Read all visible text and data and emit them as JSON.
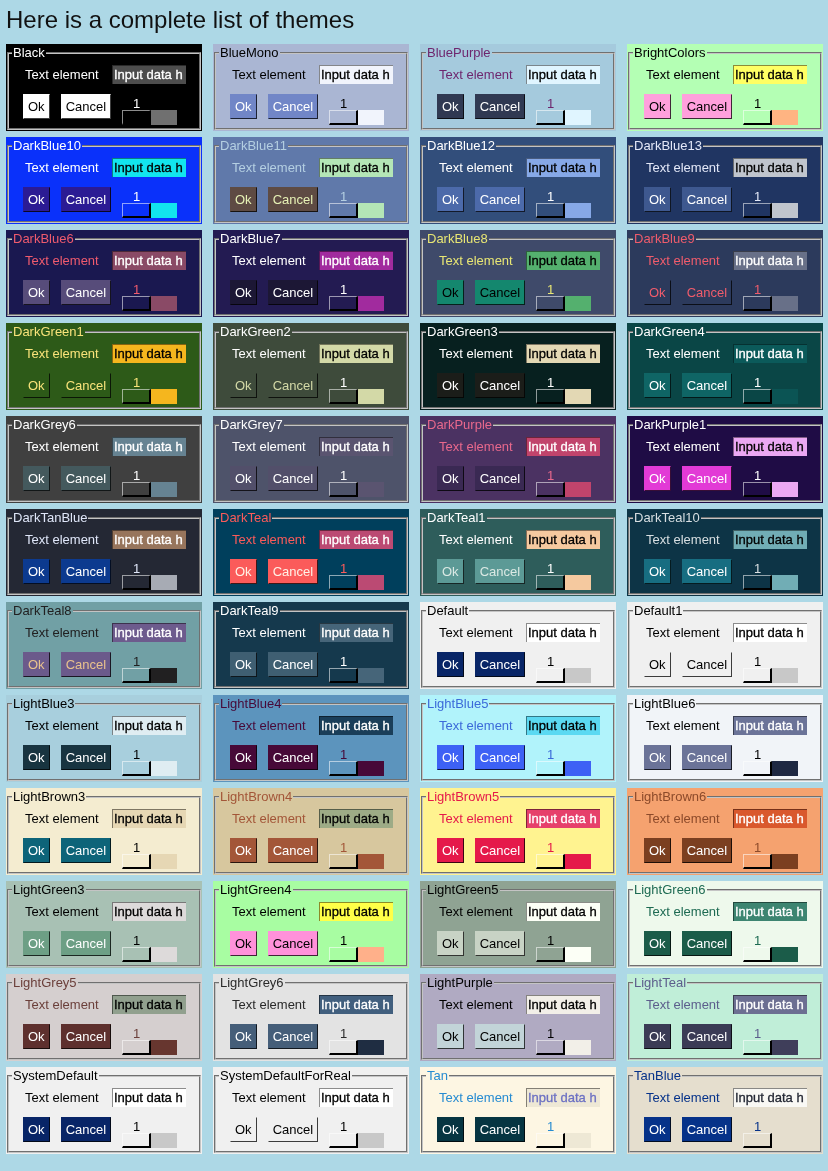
{
  "title": "Here is a complete list of themes",
  "themes": [
    {
      "name": "Black",
      "color": "#000000",
      "foreground": {
        "color": "#ffffff"
      },
      "label": "Text element",
      "input": {
        "value": "Input data h",
        "color": "#4d4d4d",
        "foreground": {
          "color": "#ffffff"
        }
      },
      "button": {
        "color": "#ffffff",
        "foreground": {
          "color": "#000000"
        }
      },
      "buttons": [
        "Ok",
        "Cancel"
      ],
      "slider": {
        "value": "1",
        "level": 0,
        "color": "#707070"
      }
    },
    {
      "name": "BlueMono",
      "color": "#aab6d3",
      "foreground": {
        "color": "#000000"
      },
      "label": "Text element",
      "input": {
        "value": "Input data h",
        "color": "#f1f4fc",
        "foreground": {
          "color": "#000000"
        }
      },
      "button": {
        "color": "#7186c7",
        "foreground": {
          "color": "#ffffff"
        }
      },
      "buttons": [
        "Ok",
        "Cancel"
      ],
      "slider": {
        "value": "1",
        "level": 0,
        "color": "#f1f4fc"
      }
    },
    {
      "name": "BluePurple",
      "color": "#a5cadd",
      "foreground": {
        "color": "#6e266e"
      },
      "label": "Text element",
      "input": {
        "value": "Input data h",
        "color": "#e0f5ff",
        "foreground": {
          "color": "#000000"
        }
      },
      "button": {
        "color": "#303952",
        "foreground": {
          "color": "#ffffff"
        }
      },
      "buttons": [
        "Ok",
        "Cancel"
      ],
      "slider": {
        "value": "1",
        "level": 0,
        "color": "#e0f5ff"
      }
    },
    {
      "name": "BrightColors",
      "color": "#b4ffb4",
      "foreground": {
        "color": "#000000"
      },
      "label": "Text element",
      "input": {
        "value": "Input data h",
        "color": "#ffff64",
        "foreground": {
          "color": "#000000"
        }
      },
      "button": {
        "color": "#ffa0dc",
        "foreground": {
          "color": "#000000"
        }
      },
      "buttons": [
        "Ok",
        "Cancel"
      ],
      "slider": {
        "value": "1",
        "level": 0,
        "color": "#ffb482"
      }
    },
    {
      "name": "DarkBlue10",
      "color": "#0a31fa",
      "foreground": {
        "color": "#ffffff"
      },
      "label": "Text element",
      "input": {
        "value": "Input data h",
        "color": "#12e5ee",
        "foreground": {
          "color": "#000000"
        }
      },
      "button": {
        "color": "#2b1b94",
        "foreground": {
          "color": "#ffffff"
        }
      },
      "buttons": [
        "Ok",
        "Cancel"
      ],
      "slider": {
        "value": "1",
        "level": 0,
        "color": "#12e5ee"
      }
    },
    {
      "name": "DarkBlue11",
      "color": "#6079aa",
      "foreground": {
        "color": "#b4cfe2"
      },
      "label": "Text element",
      "input": {
        "value": "Input data h",
        "color": "#b4e6b6",
        "foreground": {
          "color": "#000000"
        }
      },
      "button": {
        "color": "#5e4b43",
        "foreground": {
          "color": "#e6f1b5"
        }
      },
      "buttons": [
        "Ok",
        "Cancel"
      ],
      "slider": {
        "value": "1",
        "level": 0,
        "color": "#b4e6b6"
      }
    },
    {
      "name": "DarkBlue12",
      "color": "#324e7b",
      "foreground": {
        "color": "#ffffff"
      },
      "label": "Text element",
      "input": {
        "value": "Input data h",
        "color": "#86a8e7",
        "foreground": {
          "color": "#000000"
        }
      },
      "button": {
        "color": "#4c6aaa",
        "foreground": {
          "color": "#ffffff"
        }
      },
      "buttons": [
        "Ok",
        "Cancel"
      ],
      "slider": {
        "value": "1",
        "level": 0,
        "color": "#86a8e7"
      }
    },
    {
      "name": "DarkBlue13",
      "color": "#203562",
      "foreground": {
        "color": "#e3e8f8"
      },
      "label": "Text element",
      "input": {
        "value": "Input data h",
        "color": "#c0c5cd",
        "foreground": {
          "color": "#000000"
        }
      },
      "button": {
        "color": "#3e588f",
        "foreground": {
          "color": "#ffffff"
        }
      },
      "buttons": [
        "Ok",
        "Cancel"
      ],
      "slider": {
        "value": "1",
        "level": 0,
        "color": "#c0c5cd"
      }
    },
    {
      "name": "DarkBlue6",
      "color": "#1a1850",
      "foreground": {
        "color": "#f05b6e"
      },
      "label": "Text element",
      "input": {
        "value": "Input data h",
        "color": "#8a4a66",
        "foreground": {
          "color": "#ffffff"
        }
      },
      "button": {
        "color": "#574c7a",
        "foreground": {
          "color": "#ffffff"
        }
      },
      "buttons": [
        "Ok",
        "Cancel"
      ],
      "slider": {
        "value": "1",
        "level": 0,
        "color": "#8a4a66"
      }
    },
    {
      "name": "DarkBlue7",
      "color": "#231b52",
      "foreground": {
        "color": "#ffffff"
      },
      "label": "Text element",
      "input": {
        "value": "Input data h",
        "color": "#a12b9e",
        "foreground": {
          "color": "#ffffff"
        }
      },
      "button": {
        "color": "#1c1735",
        "foreground": {
          "color": "#ffffff"
        }
      },
      "buttons": [
        "Ok",
        "Cancel"
      ],
      "slider": {
        "value": "1",
        "level": 0,
        "color": "#a12b9e"
      }
    },
    {
      "name": "DarkBlue8",
      "color": "#3f4a6a",
      "foreground": {
        "color": "#e8e674"
      },
      "label": "Text element",
      "input": {
        "value": "Input data h",
        "color": "#54b06e",
        "foreground": {
          "color": "#000000"
        }
      },
      "button": {
        "color": "#14876e",
        "foreground": {
          "color": "#000000"
        }
      },
      "buttons": [
        "Ok",
        "Cancel"
      ],
      "slider": {
        "value": "1",
        "level": 0,
        "color": "#54b06e"
      }
    },
    {
      "name": "DarkBlue9",
      "color": "#2c3a5c",
      "foreground": {
        "color": "#f05c6c"
      },
      "label": "Text element",
      "input": {
        "value": "Input data h",
        "color": "#687088",
        "foreground": {
          "color": "#ffffff"
        }
      },
      "button": {
        "color": "#2c3a5c",
        "foreground": {
          "color": "#f05c6c"
        }
      },
      "buttons": [
        "Ok",
        "Cancel"
      ],
      "slider": {
        "value": "1",
        "level": 0,
        "color": "#687088"
      }
    },
    {
      "name": "DarkGreen1",
      "color": "#2d5a18",
      "foreground": {
        "color": "#f9e37a"
      },
      "label": "Text element",
      "input": {
        "value": "Input data h",
        "color": "#f5b61e",
        "foreground": {
          "color": "#000000"
        }
      },
      "button": {
        "color": "#2d5a18",
        "foreground": {
          "color": "#f9e37a"
        }
      },
      "buttons": [
        "Ok",
        "Cancel"
      ],
      "slider": {
        "value": "1",
        "level": 0,
        "color": "#f5b61e"
      }
    },
    {
      "name": "DarkGreen2",
      "color": "#3e4b3b",
      "foreground": {
        "color": "#ffffff"
      },
      "label": "Text element",
      "input": {
        "value": "Input data h",
        "color": "#d3d9a7",
        "foreground": {
          "color": "#000000"
        }
      },
      "button": {
        "color": "#3e4b3b",
        "foreground": {
          "color": "#d3d9a7"
        }
      },
      "buttons": [
        "Ok",
        "Cancel"
      ],
      "slider": {
        "value": "1",
        "level": 0,
        "color": "#d3d9a7"
      }
    },
    {
      "name": "DarkGreen3",
      "color": "#07201f",
      "foreground": {
        "color": "#ffffff"
      },
      "label": "Text element",
      "input": {
        "value": "Input data h",
        "color": "#e3d8b4",
        "foreground": {
          "color": "#000000"
        }
      },
      "button": {
        "color": "#1b1d19",
        "foreground": {
          "color": "#ffffff"
        }
      },
      "buttons": [
        "Ok",
        "Cancel"
      ],
      "slider": {
        "value": "1",
        "level": 0,
        "color": "#e3d8b4"
      }
    },
    {
      "name": "DarkGreen4",
      "color": "#0a4646",
      "foreground": {
        "color": "#ffffff"
      },
      "label": "Text element",
      "input": {
        "value": "Input data h",
        "color": "#0b5a5a",
        "foreground": {
          "color": "#ffffff"
        }
      },
      "button": {
        "color": "#0f6565",
        "foreground": {
          "color": "#ffffff"
        }
      },
      "buttons": [
        "Ok",
        "Cancel"
      ],
      "slider": {
        "value": "1",
        "level": 0,
        "color": "#0b5454"
      }
    },
    {
      "name": "DarkGrey6",
      "color": "#404040",
      "foreground": {
        "color": "#ffffff"
      },
      "label": "Text element",
      "input": {
        "value": "Input data h",
        "color": "#668392",
        "foreground": {
          "color": "#ffffff"
        }
      },
      "button": {
        "color": "#44595d",
        "foreground": {
          "color": "#ffffff"
        }
      },
      "buttons": [
        "Ok",
        "Cancel"
      ],
      "slider": {
        "value": "1",
        "level": 0,
        "color": "#668392"
      }
    },
    {
      "name": "DarkGrey7",
      "color": "#4e536a",
      "foreground": {
        "color": "#ffffff"
      },
      "label": "Text element",
      "input": {
        "value": "Input data h",
        "color": "#5a5470",
        "foreground": {
          "color": "#ffffff"
        }
      },
      "button": {
        "color": "#524f6a",
        "foreground": {
          "color": "#ffffff"
        }
      },
      "buttons": [
        "Ok",
        "Cancel"
      ],
      "slider": {
        "value": "1",
        "level": 0,
        "color": "#5a5470"
      }
    },
    {
      "name": "DarkPurple",
      "color": "#4b3262",
      "foreground": {
        "color": "#e8688c"
      },
      "label": "Text element",
      "input": {
        "value": "Input data h",
        "color": "#c1446c",
        "foreground": {
          "color": "#ffffff"
        }
      },
      "button": {
        "color": "#3a2953",
        "foreground": {
          "color": "#ffffff"
        }
      },
      "buttons": [
        "Ok",
        "Cancel"
      ],
      "slider": {
        "value": "1",
        "level": 0,
        "color": "#c1446c"
      }
    },
    {
      "name": "DarkPurple1",
      "color": "#1f0c45",
      "foreground": {
        "color": "#ffffff"
      },
      "label": "Text element",
      "input": {
        "value": "Input data h",
        "color": "#eba8f3",
        "foreground": {
          "color": "#000000"
        }
      },
      "button": {
        "color": "#e23ad6",
        "foreground": {
          "color": "#ffffff"
        }
      },
      "buttons": [
        "Ok",
        "Cancel"
      ],
      "slider": {
        "value": "1",
        "level": 0,
        "color": "#eba8f3"
      }
    },
    {
      "name": "DarkTanBlue",
      "color": "#242834",
      "foreground": {
        "color": "#dfe6f8"
      },
      "label": "Text element",
      "input": {
        "value": "Input data h",
        "color": "#97755c",
        "foreground": {
          "color": "#ffffff"
        }
      },
      "button": {
        "color": "#0c3a8f",
        "foreground": {
          "color": "#ffffff"
        }
      },
      "buttons": [
        "Ok",
        "Cancel"
      ],
      "slider": {
        "value": "1",
        "level": 0,
        "color": "#a7abb4"
      }
    },
    {
      "name": "DarkTeal",
      "color": "#003f5c",
      "foreground": {
        "color": "#fb5b5a"
      },
      "label": "Text element",
      "input": {
        "value": "Input data h",
        "color": "#bb4a73",
        "foreground": {
          "color": "#ffffff"
        }
      },
      "button": {
        "color": "#fb5b5a",
        "foreground": {
          "color": "#fff1e6"
        }
      },
      "buttons": [
        "Ok",
        "Cancel"
      ],
      "slider": {
        "value": "1",
        "level": 0,
        "color": "#bb4a73"
      }
    },
    {
      "name": "DarkTeal1",
      "color": "#2e5d5b",
      "foreground": {
        "color": "#ffffff"
      },
      "label": "Text element",
      "input": {
        "value": "Input data h",
        "color": "#f5c99f",
        "foreground": {
          "color": "#000000"
        }
      },
      "button": {
        "color": "#5c9a96",
        "foreground": {
          "color": "#dbe9e4"
        }
      },
      "buttons": [
        "Ok",
        "Cancel"
      ],
      "slider": {
        "value": "1",
        "level": 0,
        "color": "#f5c99f"
      }
    },
    {
      "name": "DarkTeal10",
      "color": "#0d3446",
      "foreground": {
        "color": "#d8dfe2"
      },
      "label": "Text element",
      "input": {
        "value": "Input data h",
        "color": "#71adb5",
        "foreground": {
          "color": "#000000"
        }
      },
      "button": {
        "color": "#176d81",
        "foreground": {
          "color": "#ffffff"
        }
      },
      "buttons": [
        "Ok",
        "Cancel"
      ],
      "slider": {
        "value": "1",
        "level": 0,
        "color": "#71adb5"
      }
    },
    {
      "name": "DarkTeal8",
      "color": "#71a0a5",
      "foreground": {
        "color": "#212021"
      },
      "label": "Text element",
      "input": {
        "value": "Input data h",
        "color": "#6d5b8d",
        "foreground": {
          "color": "#ffffff"
        }
      },
      "button": {
        "color": "#6b5a8b",
        "foreground": {
          "color": "#e9c28d"
        }
      },
      "buttons": [
        "Ok",
        "Cancel"
      ],
      "slider": {
        "value": "1",
        "level": 0,
        "color": "#212021"
      }
    },
    {
      "name": "DarkTeal9",
      "color": "#15394d",
      "foreground": {
        "color": "#ffffff"
      },
      "label": "Text element",
      "input": {
        "value": "Input data h",
        "color": "#466579",
        "foreground": {
          "color": "#ffffff"
        }
      },
      "button": {
        "color": "#3f5f72",
        "foreground": {
          "color": "#ffffff"
        }
      },
      "buttons": [
        "Ok",
        "Cancel"
      ],
      "slider": {
        "value": "1",
        "level": 0,
        "color": "#466579"
      }
    },
    {
      "name": "Default",
      "color": "#f0f0f0",
      "foreground": {
        "color": "#000000"
      },
      "label": "Text element",
      "input": {
        "value": "Input data h",
        "color": "#ffffff",
        "foreground": {
          "color": "#000000"
        }
      },
      "button": {
        "color": "#082567",
        "foreground": {
          "color": "#ffffff"
        }
      },
      "buttons": [
        "Ok",
        "Cancel"
      ],
      "slider": {
        "value": "1",
        "level": 0,
        "color": "#c8c8c8"
      }
    },
    {
      "name": "Default1",
      "color": "#f0f0f0",
      "foreground": {
        "color": "#000000"
      },
      "label": "Text element",
      "input": {
        "value": "Input data h",
        "color": "#ffffff",
        "foreground": {
          "color": "#000000"
        }
      },
      "button": {
        "color": "#f0f0f0",
        "foreground": {
          "color": "#000000"
        }
      },
      "buttons": [
        "Ok",
        "Cancel"
      ],
      "slider": {
        "value": "1",
        "level": 0,
        "color": "#c8c8c8"
      }
    },
    {
      "name": "LightBlue3",
      "color": "#a8cfdd",
      "foreground": {
        "color": "#000000"
      },
      "label": "Text element",
      "input": {
        "value": "Input data h",
        "color": "#dfedf2",
        "foreground": {
          "color": "#000000"
        }
      },
      "button": {
        "color": "#183440",
        "foreground": {
          "color": "#ffffff"
        }
      },
      "buttons": [
        "Ok",
        "Cancel"
      ],
      "slider": {
        "value": "1",
        "level": 0,
        "color": "#dfedf2"
      }
    },
    {
      "name": "LightBlue4",
      "color": "#5c94bd",
      "foreground": {
        "color": "#470938"
      },
      "label": "Text element",
      "input": {
        "value": "Input data h",
        "color": "#1a3e59",
        "foreground": {
          "color": "#ffffff"
        }
      },
      "button": {
        "color": "#470938",
        "foreground": {
          "color": "#ffffff"
        }
      },
      "buttons": [
        "Ok",
        "Cancel"
      ],
      "slider": {
        "value": "1",
        "level": 0,
        "color": "#470938"
      }
    },
    {
      "name": "LightBlue5",
      "color": "#b1f3fb",
      "foreground": {
        "color": "#3b6ad9"
      },
      "label": "Text element",
      "input": {
        "value": "Input data h",
        "color": "#5bd9f2",
        "foreground": {
          "color": "#000000"
        }
      },
      "button": {
        "color": "#3d61f5",
        "foreground": {
          "color": "#ffffff"
        }
      },
      "buttons": [
        "Ok",
        "Cancel"
      ],
      "slider": {
        "value": "1",
        "level": 0,
        "color": "#3d61f5"
      }
    },
    {
      "name": "LightBlue6",
      "color": "#f1f4f8",
      "foreground": {
        "color": "#000000"
      },
      "label": "Text element",
      "input": {
        "value": "Input data h",
        "color": "#6b7398",
        "foreground": {
          "color": "#ffffff"
        }
      },
      "button": {
        "color": "#6b7398",
        "foreground": {
          "color": "#ffffff"
        }
      },
      "buttons": [
        "Ok",
        "Cancel"
      ],
      "slider": {
        "value": "1",
        "level": 0,
        "color": "#1e2842"
      }
    },
    {
      "name": "LightBrown3",
      "color": "#f4ecd0",
      "foreground": {
        "color": "#000000"
      },
      "label": "Text element",
      "input": {
        "value": "Input data h",
        "color": "#e6d7b4",
        "foreground": {
          "color": "#000000"
        }
      },
      "button": {
        "color": "#0d6479",
        "foreground": {
          "color": "#ffffff"
        }
      },
      "buttons": [
        "Ok",
        "Cancel"
      ],
      "slider": {
        "value": "1",
        "level": 0,
        "color": "#e6d7b4"
      }
    },
    {
      "name": "LightBrown4",
      "color": "#d7c79e",
      "foreground": {
        "color": "#a35638"
      },
      "label": "Text element",
      "input": {
        "value": "Input data h",
        "color": "#9dab86",
        "foreground": {
          "color": "#000000"
        }
      },
      "button": {
        "color": "#a35638",
        "foreground": {
          "color": "#ffffff"
        }
      },
      "buttons": [
        "Ok",
        "Cancel"
      ],
      "slider": {
        "value": "1",
        "level": 0,
        "color": "#a35638"
      }
    },
    {
      "name": "LightBrown5",
      "color": "#fff390",
      "foreground": {
        "color": "#e5194a"
      },
      "label": "Text element",
      "input": {
        "value": "Input data h",
        "color": "#e6406b",
        "foreground": {
          "color": "#ffffff"
        }
      },
      "button": {
        "color": "#e5194a",
        "foreground": {
          "color": "#ffffff"
        }
      },
      "buttons": [
        "Ok",
        "Cancel"
      ],
      "slider": {
        "value": "1",
        "level": 0,
        "color": "#e5194a"
      }
    },
    {
      "name": "LightBrown6",
      "color": "#f5a26f",
      "foreground": {
        "color": "#8c4a2a"
      },
      "label": "Text element",
      "input": {
        "value": "Input data h",
        "color": "#d9582d",
        "foreground": {
          "color": "#ffffff"
        }
      },
      "button": {
        "color": "#7b3f20",
        "foreground": {
          "color": "#ffffff"
        }
      },
      "buttons": [
        "Ok",
        "Cancel"
      ],
      "slider": {
        "value": "1",
        "level": 0,
        "color": "#7b3f20"
      }
    },
    {
      "name": "LightGreen3",
      "color": "#a8c1b4",
      "foreground": {
        "color": "#000000"
      },
      "label": "Text element",
      "input": {
        "value": "Input data h",
        "color": "#dddada",
        "foreground": {
          "color": "#000000"
        }
      },
      "button": {
        "color": "#6d9f85",
        "foreground": {
          "color": "#ffffff"
        }
      },
      "buttons": [
        "Ok",
        "Cancel"
      ],
      "slider": {
        "value": "1",
        "level": 0,
        "color": "#dddada"
      }
    },
    {
      "name": "LightGreen4",
      "color": "#a8fda2",
      "foreground": {
        "color": "#000000"
      },
      "label": "Text element",
      "input": {
        "value": "Input data h",
        "color": "#ffff48",
        "foreground": {
          "color": "#000000"
        }
      },
      "button": {
        "color": "#ff91da",
        "foreground": {
          "color": "#000000"
        }
      },
      "buttons": [
        "Ok",
        "Cancel"
      ],
      "slider": {
        "value": "1",
        "level": 0,
        "color": "#ffb08a"
      }
    },
    {
      "name": "LightGreen5",
      "color": "#8fa393",
      "foreground": {
        "color": "#000000"
      },
      "label": "Text element",
      "input": {
        "value": "Input data h",
        "color": "#fcfff6",
        "foreground": {
          "color": "#000000"
        }
      },
      "button": {
        "color": "#c8d3c5",
        "foreground": {
          "color": "#000000"
        }
      },
      "buttons": [
        "Ok",
        "Cancel"
      ],
      "slider": {
        "value": "1",
        "level": 0,
        "color": "#fcfff6"
      }
    },
    {
      "name": "LightGreen6",
      "color": "#eef9ec",
      "foreground": {
        "color": "#1d6a52"
      },
      "label": "Text element",
      "input": {
        "value": "Input data h",
        "color": "#3d8571",
        "foreground": {
          "color": "#ffffff"
        }
      },
      "button": {
        "color": "#1b5c49",
        "foreground": {
          "color": "#ffffff"
        }
      },
      "buttons": [
        "Ok",
        "Cancel"
      ],
      "slider": {
        "value": "1",
        "level": 0,
        "color": "#1b5c49"
      }
    },
    {
      "name": "LightGrey5",
      "color": "#d5cfcf",
      "foreground": {
        "color": "#6b3f3a"
      },
      "label": "Text element",
      "input": {
        "value": "Input data h",
        "color": "#91a08e",
        "foreground": {
          "color": "#000000"
        }
      },
      "button": {
        "color": "#5e302e",
        "foreground": {
          "color": "#ffffff"
        }
      },
      "buttons": [
        "Ok",
        "Cancel"
      ],
      "slider": {
        "value": "1",
        "level": 0,
        "color": "#67362f"
      }
    },
    {
      "name": "LightGrey6",
      "color": "#e3e3e3",
      "foreground": {
        "color": "#2a2a2a"
      },
      "label": "Text element",
      "input": {
        "value": "Input data h",
        "color": "#415f7e",
        "foreground": {
          "color": "#ffffff"
        }
      },
      "button": {
        "color": "#455e79",
        "foreground": {
          "color": "#ffffff"
        }
      },
      "buttons": [
        "Ok",
        "Cancel"
      ],
      "slider": {
        "value": "1",
        "level": 0,
        "color": "#1f2d42"
      }
    },
    {
      "name": "LightPurple",
      "color": "#b0aac2",
      "foreground": {
        "color": "#000000"
      },
      "label": "Text element",
      "input": {
        "value": "Input data h",
        "color": "#f2efe8",
        "foreground": {
          "color": "#000000"
        }
      },
      "button": {
        "color": "#c2d4d8",
        "foreground": {
          "color": "#000000"
        }
      },
      "buttons": [
        "Ok",
        "Cancel"
      ],
      "slider": {
        "value": "1",
        "level": 0,
        "color": "#f2efe8"
      }
    },
    {
      "name": "LightTeal",
      "color": "#c0eed8",
      "foreground": {
        "color": "#5c5e8c"
      },
      "label": "Text element",
      "input": {
        "value": "Input data h",
        "color": "#6c6f92",
        "foreground": {
          "color": "#ffffff"
        }
      },
      "button": {
        "color": "#3b3b55",
        "foreground": {
          "color": "#ffffff"
        }
      },
      "buttons": [
        "Ok",
        "Cancel"
      ],
      "slider": {
        "value": "1",
        "level": 0,
        "color": "#3f3e5a"
      }
    },
    {
      "name": "SystemDefault",
      "color": "#f0f0f0",
      "foreground": {
        "color": "#000000"
      },
      "label": "Text element",
      "input": {
        "value": "Input data h",
        "color": "#ffffff",
        "foreground": {
          "color": "#000000"
        }
      },
      "button": {
        "color": "#082567",
        "foreground": {
          "color": "#ffffff"
        }
      },
      "buttons": [
        "Ok",
        "Cancel"
      ],
      "slider": {
        "value": "1",
        "level": 0,
        "color": "#c8c8c8"
      }
    },
    {
      "name": "SystemDefaultForReal",
      "color": "#f0f0f0",
      "foreground": {
        "color": "#000000"
      },
      "label": "Text element",
      "input": {
        "value": "Input data h",
        "color": "#ffffff",
        "foreground": {
          "color": "#000000"
        }
      },
      "button": {
        "color": "#f0f0f0",
        "foreground": {
          "color": "#000000"
        }
      },
      "buttons": [
        "Ok",
        "Cancel"
      ],
      "slider": {
        "value": "1",
        "level": 0,
        "color": "#c8c8c8"
      }
    },
    {
      "name": "Tan",
      "color": "#fdf6e3",
      "foreground": {
        "color": "#268bd1"
      },
      "label": "Text element",
      "input": {
        "value": "Input data h",
        "color": "#eee8d5",
        "foreground": {
          "color": "#6c71c3"
        }
      },
      "button": {
        "color": "#063542",
        "foreground": {
          "color": "#ffffff"
        }
      },
      "buttons": [
        "Ok",
        "Cancel"
      ],
      "slider": {
        "value": "1",
        "level": 0,
        "color": "#eee8d5"
      }
    },
    {
      "name": "TanBlue",
      "color": "#e5dece",
      "foreground": {
        "color": "#063289"
      },
      "label": "Text element",
      "input": {
        "value": "Input data h",
        "color": "#f9f8f4",
        "foreground": {
          "color": "#242834"
        }
      },
      "button": {
        "color": "#063289",
        "foreground": {
          "color": "#ffffff"
        }
      },
      "buttons": [
        "Ok",
        "Cancel"
      ],
      "slider": {
        "value": "1",
        "level": 0,
        "color": "#e5dece"
      }
    }
  ]
}
